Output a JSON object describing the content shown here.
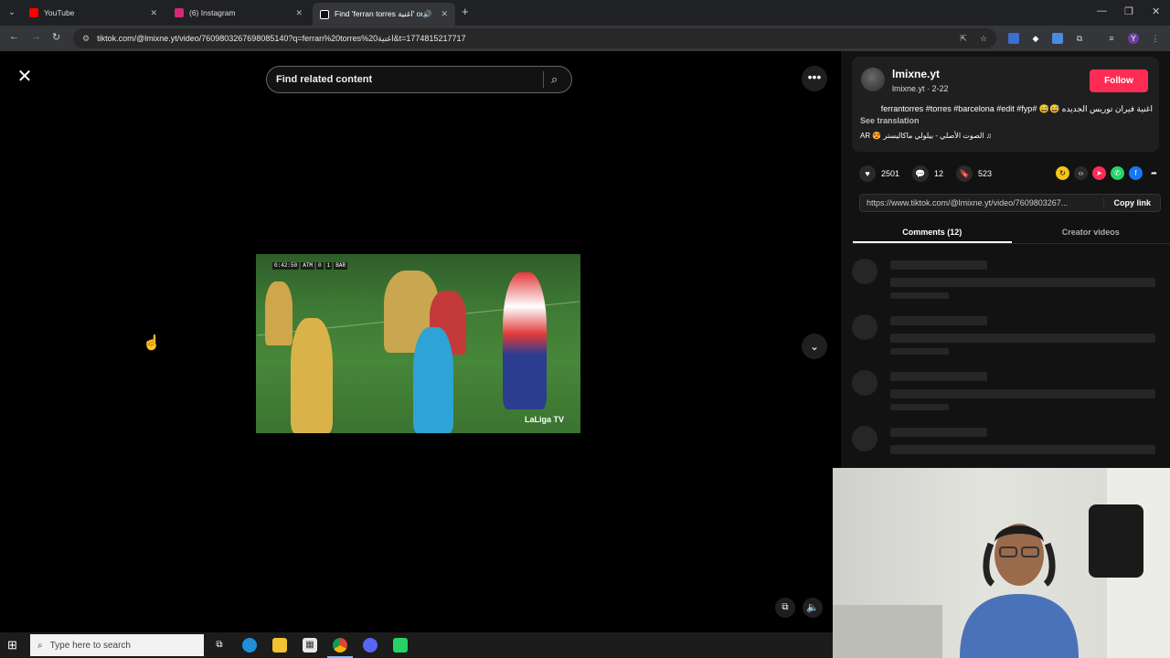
{
  "browser": {
    "tabs": [
      {
        "title": "YouTube",
        "favicon_color": "#ff0000",
        "active": false
      },
      {
        "title": "(6) Instagram",
        "favicon_color": "#d62976",
        "active": false
      },
      {
        "title": "Find 'ferran torres اغنية' on",
        "favicon_color": "#ffffff",
        "active": true
      }
    ],
    "url": "tiktok.com/@lmixne.yt/video/7609803267698085140?q=ferran%20torres%20اغنية&t=1774815217717"
  },
  "page": {
    "search_placeholder": "Find related content",
    "author": {
      "username": "lmixne.yt",
      "nickname_date": "lmixne.yt · 2-22",
      "follow_label": "Follow",
      "follow_color": "#fe2c55"
    },
    "description": "اغنية فيران توريس الجديده 😅😅 #ferrantorres #torres #barcelona #edit #fyp",
    "see_translation": "See translation",
    "music": "الصوت الأصلي - بيلولي ماكاليستر 😍 AR",
    "stats": {
      "likes": "2501",
      "comments": "12",
      "saves": "523"
    },
    "share_link": "https://www.tiktok.com/@lmixne.yt/video/7609803267...",
    "copy_link_label": "Copy link",
    "panel_tabs": [
      "Comments (12)",
      "Creator videos"
    ],
    "video_scorebug": [
      "0:42:50",
      "ATM",
      "0",
      "1",
      "BAR"
    ],
    "video_watermark": "LaLiga TV"
  },
  "taskbar": {
    "search_placeholder": "Type here to search"
  }
}
